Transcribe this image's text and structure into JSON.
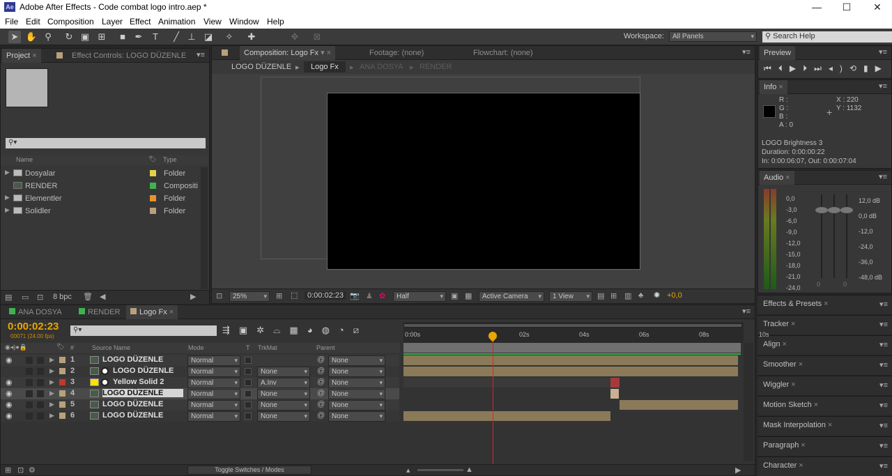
{
  "app": {
    "title": "Adobe After Effects - Code combat logo intro.aep *",
    "logo": "Ae"
  },
  "window": {
    "minimize": "—",
    "maximize": "☐",
    "close": "✕"
  },
  "menu": [
    "File",
    "Edit",
    "Composition",
    "Layer",
    "Effect",
    "Animation",
    "View",
    "Window",
    "Help"
  ],
  "toolbar": {
    "workspace_label": "Workspace:",
    "workspace_value": "All Panels",
    "search_placeholder": "Search Help"
  },
  "project": {
    "tab_project": "Project",
    "tab_effect": "Effect Controls: LOGO DÜZENLE",
    "search_placeholder": "⚲▾",
    "col_name": "Name",
    "col_type": "Type",
    "items": [
      {
        "name": "Dosyalar",
        "type": "Folder",
        "color": "#e6d14a"
      },
      {
        "name": "RENDER",
        "type": "Compositi",
        "color": "#3fb34f"
      },
      {
        "name": "Elementler",
        "type": "Folder",
        "color": "#e8922b"
      },
      {
        "name": "Solidler",
        "type": "Folder",
        "color": "#b8a17a"
      }
    ],
    "bpc": "8 bpc"
  },
  "comp": {
    "tab_comp": "Composition: Logo Fx",
    "tab_footage": "Footage: (none)",
    "tab_flow": "Flowchart: (none)",
    "crumbs": [
      "LOGO DÜZENLE",
      "Logo Fx",
      "ANA DOSYA",
      "RENDER"
    ],
    "zoom": "25%",
    "timecode": "0:00:02:23",
    "resolution": "Half",
    "camera": "Active Camera",
    "views": "1 View",
    "exposure": "+0,0"
  },
  "preview": {
    "title": "Preview"
  },
  "info": {
    "title": "Info",
    "r": "R :",
    "g": "G :",
    "b": "B :",
    "a": "A : 0",
    "x": "X : 220",
    "y": "Y : 1132",
    "layer": "LOGO Brightness 3",
    "duration": "Duration: 0:00:00:22",
    "inout": "In: 0:00:06:07, Out: 0:00:07:04"
  },
  "audio": {
    "title": "Audio",
    "left": [
      "0,0",
      "-3,0",
      "-6,0",
      "-9,0",
      "-12,0",
      "-15,0",
      "-18,0",
      "-21,0",
      "-24,0"
    ],
    "right": [
      "12,0 dB",
      "0,0 dB",
      "-12,0",
      "-24,0",
      "-36,0",
      "-48,0 dB"
    ],
    "bottom": [
      "0",
      "0"
    ]
  },
  "side_panels": [
    "Effects & Presets",
    "Tracker",
    "Align",
    "Smoother",
    "Wiggler",
    "Motion Sketch",
    "Mask Interpolation",
    "Paragraph",
    "Character"
  ],
  "timeline": {
    "tabs": [
      "ANA DOSYA",
      "RENDER",
      "Logo Fx"
    ],
    "tab_colors": [
      "#3fb34f",
      "#3fb34f",
      "#b8a17a"
    ],
    "timecode": "0:00:02:23",
    "frames": "00071 (24.00 fps)",
    "search_placeholder": "⚲▾",
    "cols": {
      "num": "#",
      "source": "Source Name",
      "mode": "Mode",
      "t": "T",
      "trkmat": "TrkMat",
      "parent": "Parent"
    },
    "ruler": [
      "0:00s",
      "02s",
      "04s",
      "06s",
      "08s",
      "10s"
    ],
    "layers": [
      {
        "num": "1",
        "name": "LOGO  DÜZENLE",
        "mode": "Normal",
        "trkmat": "",
        "parent": "None",
        "color": "#b8a17a",
        "solid": false
      },
      {
        "num": "2",
        "name": "LOGO  DÜZENLE",
        "mode": "Normal",
        "trkmat": "None",
        "parent": "None",
        "color": "#b8a17a",
        "solid": false
      },
      {
        "num": "3",
        "name": "Yellow Solid 2",
        "mode": "Normal",
        "trkmat": "A.Inv",
        "parent": "None",
        "color": "#c0392b",
        "solid": true
      },
      {
        "num": "4",
        "name": "LOGO  DÜZENLE",
        "mode": "Normal",
        "trkmat": "None",
        "parent": "None",
        "color": "#b8a17a",
        "solid": false
      },
      {
        "num": "5",
        "name": "LOGO  DÜZENLE",
        "mode": "Normal",
        "trkmat": "None",
        "parent": "None",
        "color": "#b8a17a",
        "solid": false
      },
      {
        "num": "6",
        "name": "LOGO  DÜZENLE",
        "mode": "Normal",
        "trkmat": "None",
        "parent": "None",
        "color": "#b8a17a",
        "solid": false
      }
    ],
    "toggle": "Toggle Switches / Modes"
  }
}
